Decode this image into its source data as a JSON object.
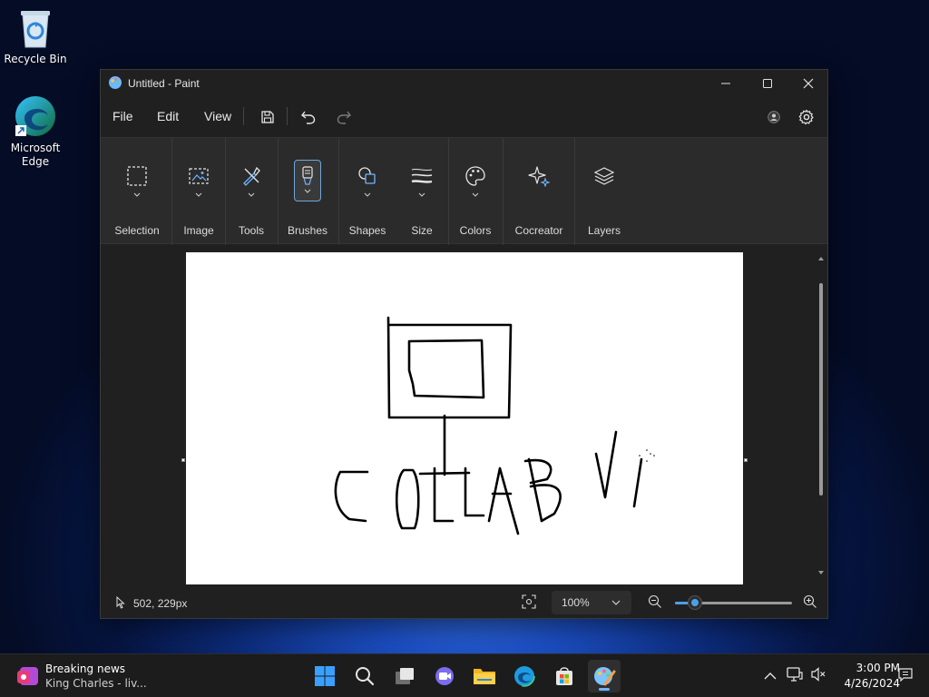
{
  "desktop": {
    "icons": [
      {
        "label": "Recycle Bin"
      },
      {
        "label": "Microsoft Edge"
      }
    ]
  },
  "window": {
    "title": "Untitled - Paint",
    "menu": [
      "File",
      "Edit",
      "View"
    ],
    "ribbon_groups": [
      {
        "label": "Selection",
        "icon": "selection-icon"
      },
      {
        "label": "Image",
        "icon": "image-icon"
      },
      {
        "label": "Tools",
        "icon": "tools-icon"
      },
      {
        "label": "Brushes",
        "icon": "brush-icon",
        "active": true
      },
      {
        "label": "Shapes",
        "icon": "shapes-icon"
      },
      {
        "label": "Size",
        "icon": "size-icon"
      },
      {
        "label": "Colors",
        "icon": "palette-icon"
      },
      {
        "label": "Cocreator",
        "icon": "sparkle-icon"
      },
      {
        "label": "Layers",
        "icon": "layers-icon"
      }
    ],
    "status": {
      "cursor_position": "502, 229px",
      "zoom_value": "100%",
      "zoom_level": 0.17
    },
    "colors": {
      "accent": "#4ca0e8",
      "window_bg": "#202020",
      "ribbon_bg": "#2b2b2b",
      "canvas_bg": "#ffffff"
    }
  },
  "taskbar": {
    "news_headline": "Breaking news",
    "news_subtitle": "King Charles - liv...",
    "apps": [
      "start-icon",
      "search-icon",
      "task-view-icon",
      "teams-icon",
      "file-explorer-icon",
      "edge-icon",
      "store-icon",
      "paint-icon"
    ],
    "time": "3:00 PM",
    "date": "4/26/2024"
  }
}
